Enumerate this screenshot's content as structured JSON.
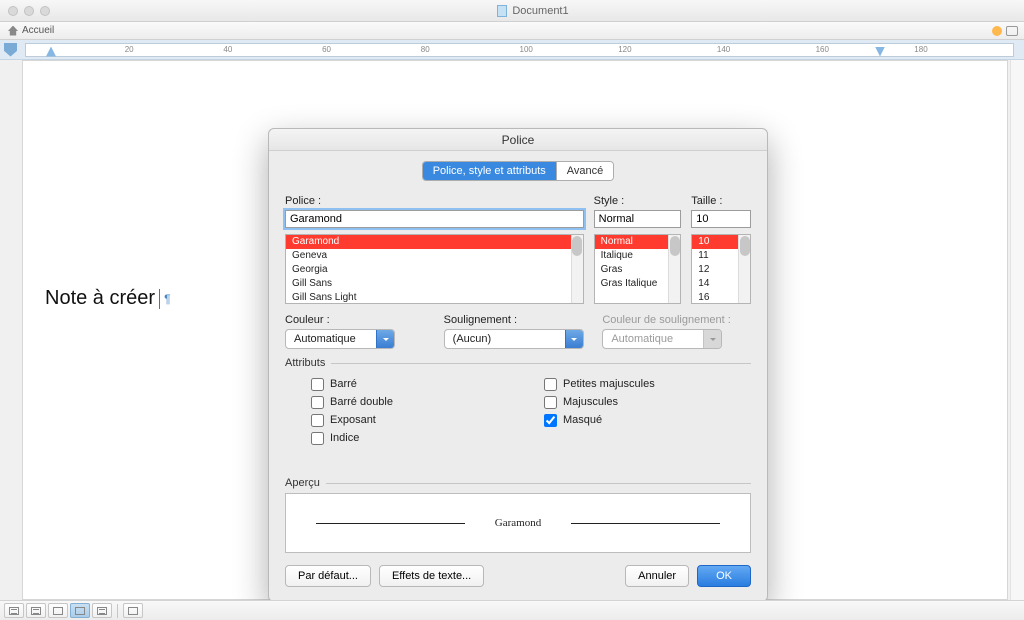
{
  "window": {
    "title": "Document1"
  },
  "toolbar": {
    "home": "Accueil"
  },
  "ruler": {
    "ticks": [
      "20",
      "40",
      "60",
      "80",
      "100",
      "120",
      "140",
      "160",
      "180"
    ]
  },
  "document": {
    "text": "Note à créer",
    "pilcrow": "¶"
  },
  "dialog": {
    "title": "Police",
    "tabs": {
      "main": "Police, style et attributs",
      "advanced": "Avancé"
    },
    "labels": {
      "police": "Police :",
      "style": "Style :",
      "taille": "Taille :",
      "couleur": "Couleur :",
      "soulignement": "Soulignement :",
      "coul_soul": "Couleur de soulignement :",
      "attributs": "Attributs",
      "apercu": "Aperçu"
    },
    "inputs": {
      "police": "Garamond",
      "style": "Normal",
      "taille": "10"
    },
    "font_list": [
      "Garamond",
      "Geneva",
      "Georgia",
      "Gill Sans",
      "Gill Sans Light"
    ],
    "style_list": [
      "Normal",
      "Italique",
      "Gras",
      "Gras Italique"
    ],
    "size_list": [
      "10",
      "11",
      "12",
      "14",
      "16"
    ],
    "couleur": "Automatique",
    "soulignement": "(Aucun)",
    "coul_soul": "Automatique",
    "attrs_left": {
      "barre": "Barré",
      "barre_double": "Barré double",
      "exposant": "Exposant",
      "indice": "Indice"
    },
    "attrs_right": {
      "petites_maj": "Petites majuscules",
      "majuscules": "Majuscules",
      "masque": "Masqué"
    },
    "checked": {
      "masque": true
    },
    "preview_text": "Garamond",
    "buttons": {
      "defaut": "Par défaut...",
      "effets": "Effets de texte...",
      "annuler": "Annuler",
      "ok": "OK"
    }
  }
}
